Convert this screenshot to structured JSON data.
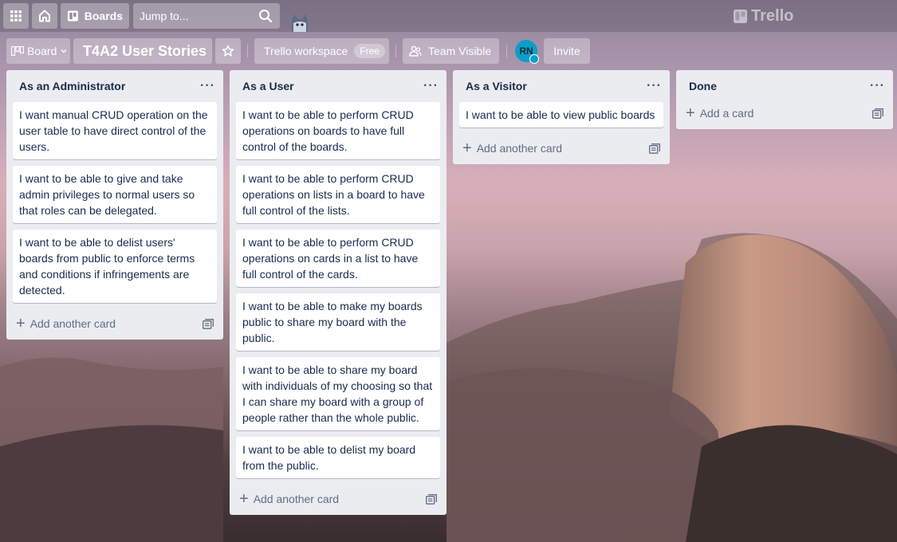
{
  "header": {
    "apps_icon": "grid-icon",
    "home_icon": "home-icon",
    "boards_label": "Boards",
    "search_placeholder": "Jump to...",
    "brand": "Trello"
  },
  "board_bar": {
    "view_label": "Board",
    "title": "T4A2 User Stories",
    "workspace_label": "Trello workspace",
    "workspace_badge": "Free",
    "visibility_label": "Team Visible",
    "avatar_initials": "RN",
    "invite_label": "Invite"
  },
  "lists": [
    {
      "title": "As an Administrator",
      "cards": [
        "I want manual CRUD operation on the user table to have direct control of the users.",
        "I want to be able to give and take admin privileges to normal users so that roles can be delegated.",
        "I want to be able to delist users' boards from public to enforce terms and conditions if infringements are detected."
      ],
      "footer": "Add another card"
    },
    {
      "title": "As a User",
      "cards": [
        "I want to be able to perform CRUD operations on boards to have full control of the boards.",
        "I want to be able to perform CRUD operations on lists in a board to have full control of the lists.",
        "I want to be able to perform CRUD operations on cards in a list to have full control of the cards.",
        "I want to be able to make my boards public to share my board with the public.",
        "I want to be able to share my board with individuals of my choosing so that I can share my board with a group of people rather than the whole public.",
        "I want to be able to delist my board from the public."
      ],
      "footer": "Add another card"
    },
    {
      "title": "As a Visitor",
      "cards": [
        "I want to be able to view public boards"
      ],
      "footer": "Add another card"
    },
    {
      "title": "Done",
      "cards": [],
      "footer": "Add a card"
    }
  ],
  "colors": {
    "list_bg": "#ebecf0",
    "card_text": "#172b4d",
    "muted_text": "#5e6c84",
    "avatar_bg": "#0a9fc7"
  }
}
